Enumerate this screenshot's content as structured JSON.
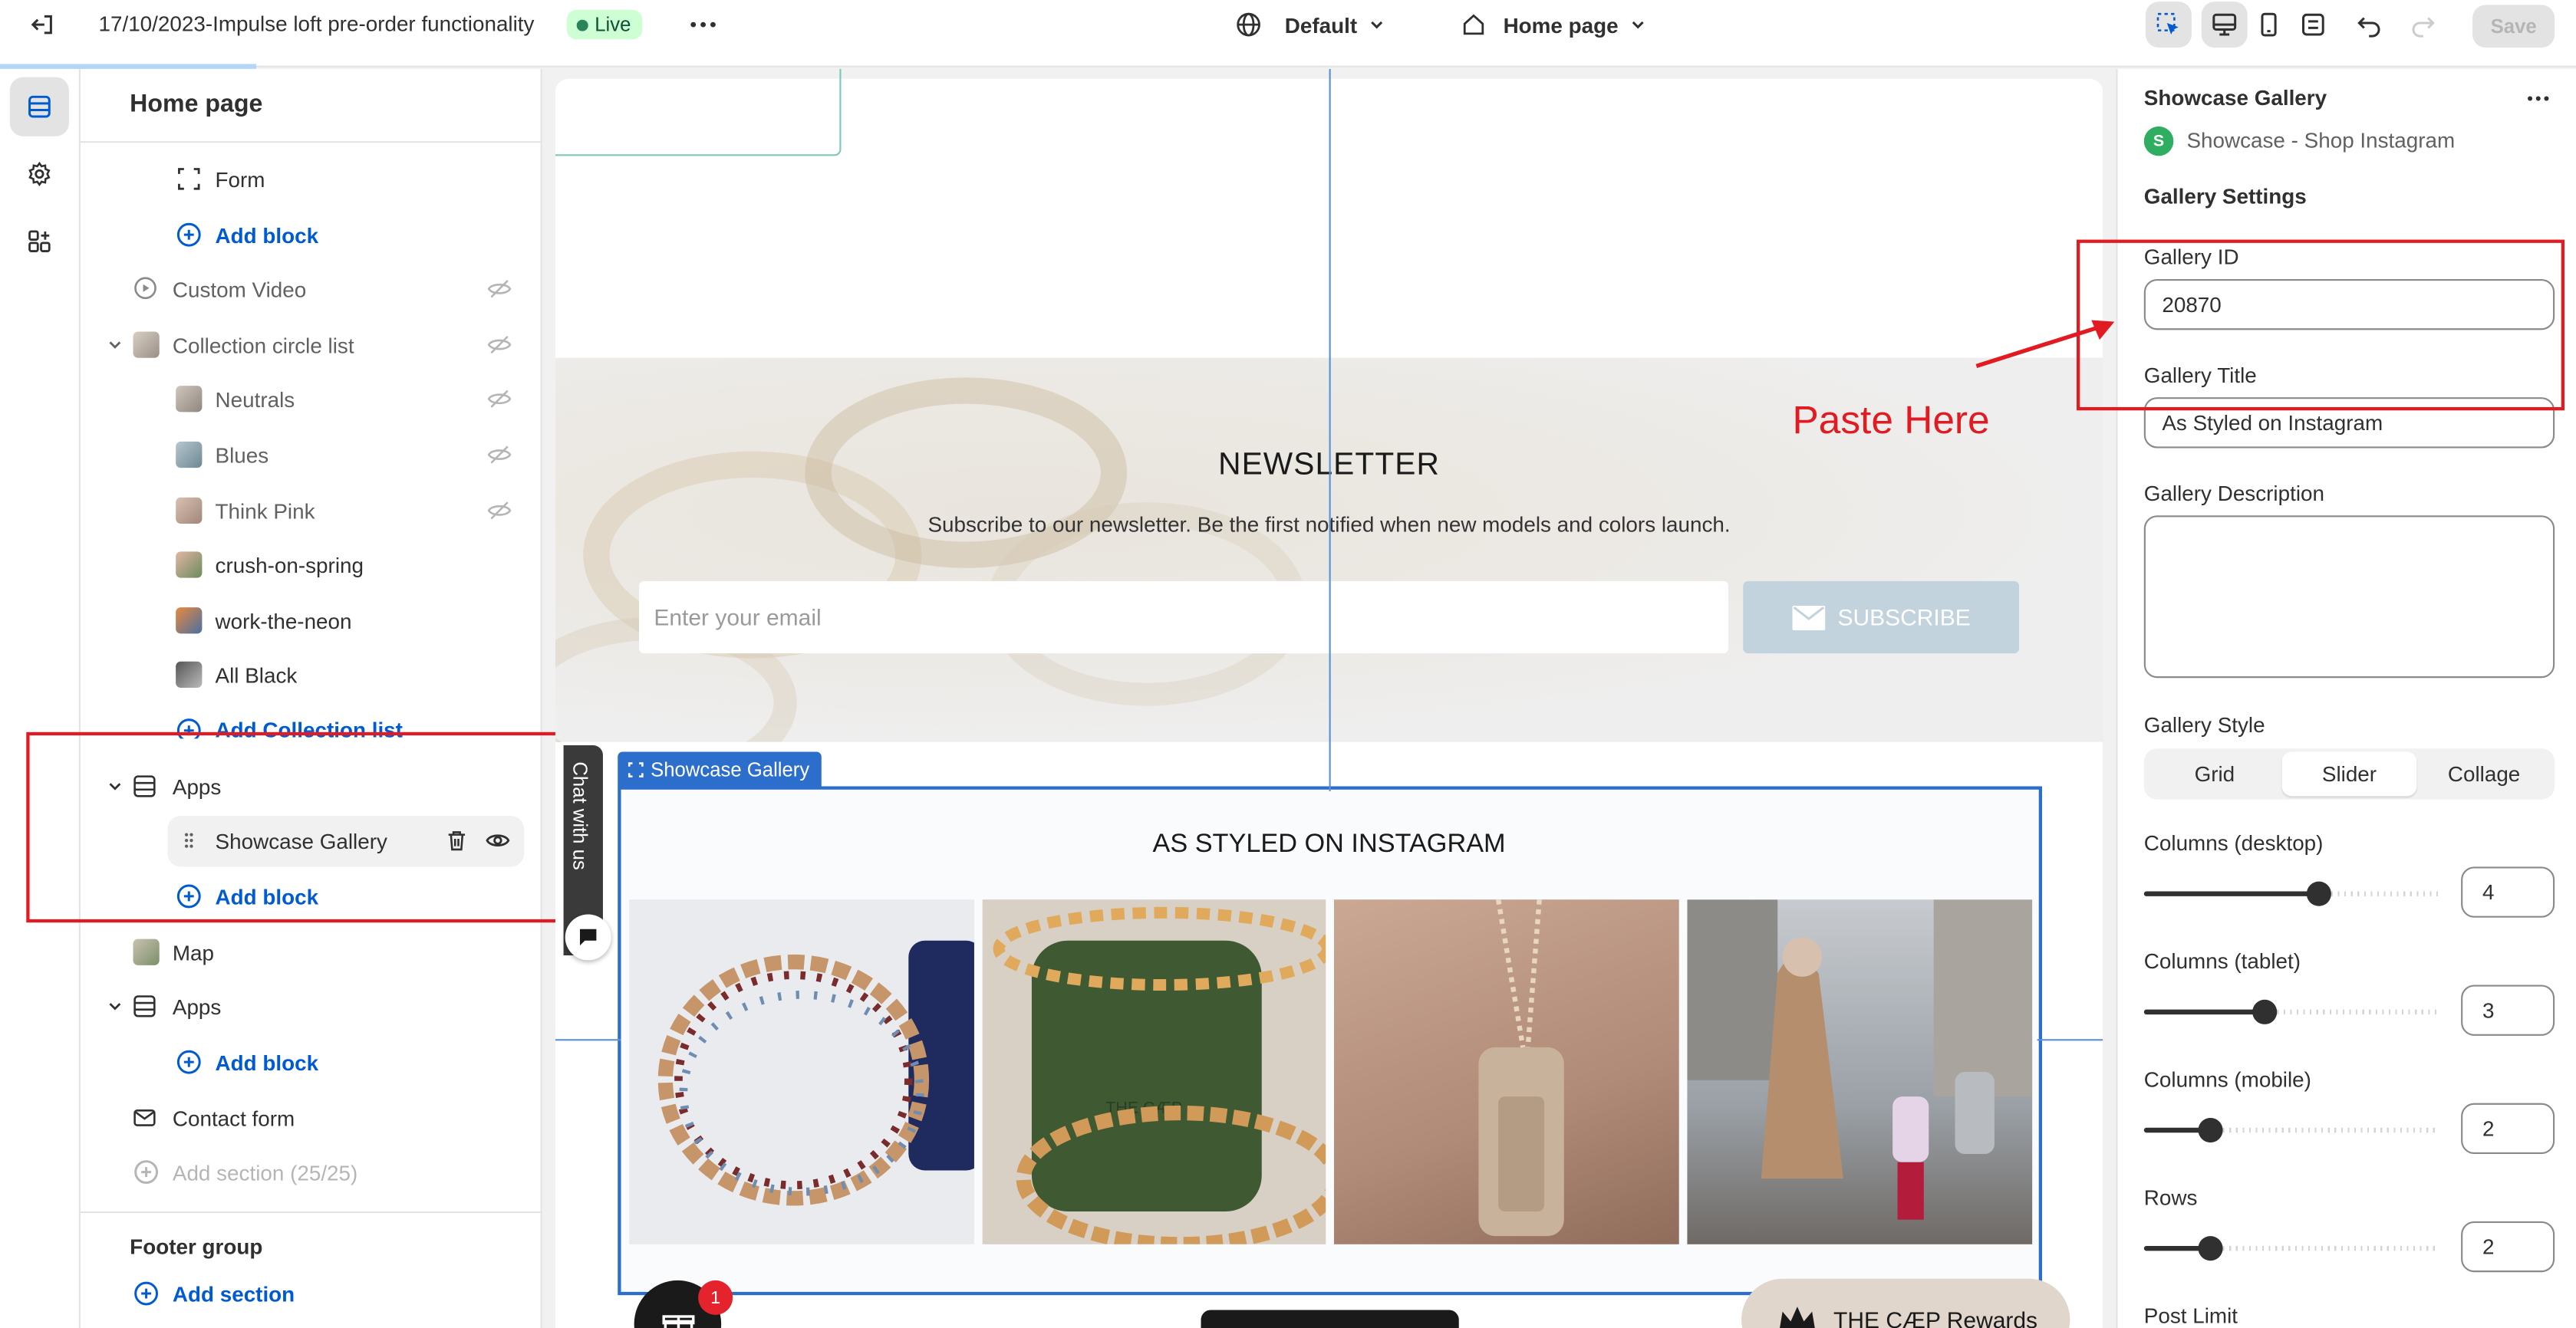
{
  "topbar": {
    "store_title": "17/10/2023-Impulse loft pre-order functionality",
    "status_badge": "Live",
    "theme_selector": "Default",
    "page_selector": "Home page",
    "save_label": "Save"
  },
  "sidebar": {
    "title": "Home page",
    "items": {
      "form": "Form",
      "add_block_1": "Add block",
      "custom_video": "Custom Video",
      "collection_circle_list": "Collection circle list",
      "neutrals": "Neutrals",
      "blues": "Blues",
      "think_pink": "Think Pink",
      "crush_on_spring": "crush-on-spring",
      "work_the_neon": "work-the-neon",
      "all_black": "All Black",
      "add_collection_list": "Add Collection list",
      "apps_1": "Apps",
      "showcase_gallery": "Showcase Gallery",
      "add_block_2": "Add block",
      "map": "Map",
      "apps_2": "Apps",
      "add_block_3": "Add block",
      "contact_form": "Contact form",
      "add_section": "Add section (25/25)"
    },
    "footer": {
      "title": "Footer group",
      "add_section": "Add section"
    }
  },
  "canvas": {
    "newsletter": {
      "heading": "NEWSLETTER",
      "subtitle": "Subscribe to our newsletter. Be the first notified when new models and colors launch.",
      "email_placeholder": "Enter your email",
      "subscribe_label": "SUBSCRIBE"
    },
    "selected_section_tag": "Showcase Gallery",
    "gallery_heading": "AS STYLED ON INSTAGRAM",
    "chat_tab": "Chat with us",
    "rewards_badge_count": "1",
    "rewards_label": "THE CÆP Rewards",
    "annotation": "Paste Here",
    "phone_imprint": "THE CÆP"
  },
  "panel": {
    "title": "Showcase Gallery",
    "app_name": "Showcase - Shop Instagram",
    "app_icon_letter": "S",
    "section_heading": "Gallery Settings",
    "gallery_id_label": "Gallery ID",
    "gallery_id_value": "20870",
    "gallery_title_label": "Gallery Title",
    "gallery_title_value": "As Styled on Instagram",
    "gallery_description_label": "Gallery Description",
    "gallery_style_label": "Gallery Style",
    "style_options": [
      "Grid",
      "Slider",
      "Collage"
    ],
    "style_selected": "Slider",
    "columns_desktop_label": "Columns (desktop)",
    "columns_desktop": "4",
    "columns_tablet_label": "Columns (tablet)",
    "columns_tablet": "3",
    "columns_mobile_label": "Columns (mobile)",
    "columns_mobile": "2",
    "rows_label": "Rows",
    "rows": "2",
    "post_limit_label": "Post Limit"
  },
  "colors": {
    "accent_blue": "#005bd3",
    "annotation_red": "#e21b22",
    "live_green": "#29845a"
  }
}
